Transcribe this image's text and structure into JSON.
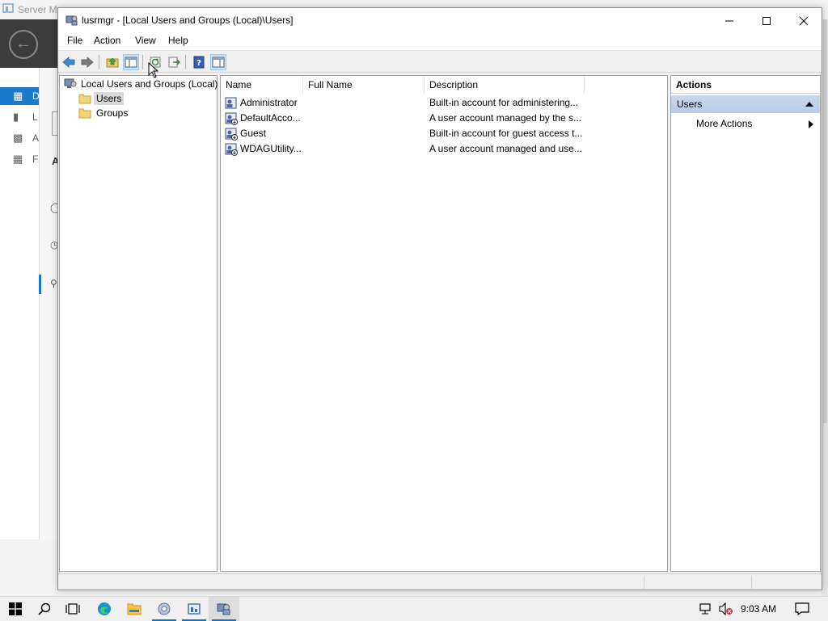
{
  "background_app": {
    "title": "Server Ma",
    "nav_letters": [
      "D",
      "L",
      "A",
      "F"
    ],
    "content_letter": "A"
  },
  "window": {
    "title": "lusrmgr - [Local Users and Groups (Local)\\Users]",
    "minimize_icon": "minimize-icon",
    "maximize_icon": "maximize-icon",
    "close_icon": "close-icon"
  },
  "menu": {
    "items": [
      {
        "label": "File"
      },
      {
        "label": "Action"
      },
      {
        "label": "View"
      },
      {
        "label": "Help"
      }
    ]
  },
  "toolbar": {
    "buttons": [
      "back-icon",
      "forward-icon",
      "up-folder-icon",
      "show-hide-tree-icon",
      "refresh-icon",
      "export-list-icon",
      "help-icon",
      "show-hide-action-pane-icon"
    ]
  },
  "tree": {
    "root": "Local Users and Groups (Local)",
    "children": [
      {
        "label": "Users",
        "selected": true
      },
      {
        "label": "Groups",
        "selected": false
      }
    ]
  },
  "list": {
    "columns": [
      {
        "label": "Name"
      },
      {
        "label": "Full Name"
      },
      {
        "label": "Description"
      }
    ],
    "rows": [
      {
        "name": "Administrator",
        "full_name": "",
        "description": "Built-in account for administering..."
      },
      {
        "name": "DefaultAcco...",
        "full_name": "",
        "description": "A user account managed by the s..."
      },
      {
        "name": "Guest",
        "full_name": "",
        "description": "Built-in account for guest access t..."
      },
      {
        "name": "WDAGUtility...",
        "full_name": "",
        "description": "A user account managed and use..."
      }
    ]
  },
  "actions": {
    "header": "Actions",
    "group": "Users",
    "items": [
      {
        "label": "More Actions"
      }
    ]
  },
  "taskbar": {
    "items": [
      "windows-start-icon",
      "search-icon",
      "task-view-icon",
      "edge-icon",
      "file-explorer-icon",
      "control-panel-icon",
      "server-manager-icon",
      "lusrmgr-icon"
    ],
    "clock": "9:03 AM"
  },
  "colors": {
    "accent": "#0078d7",
    "selection": "#d9d9d9",
    "action_group": "#b7cce6"
  }
}
